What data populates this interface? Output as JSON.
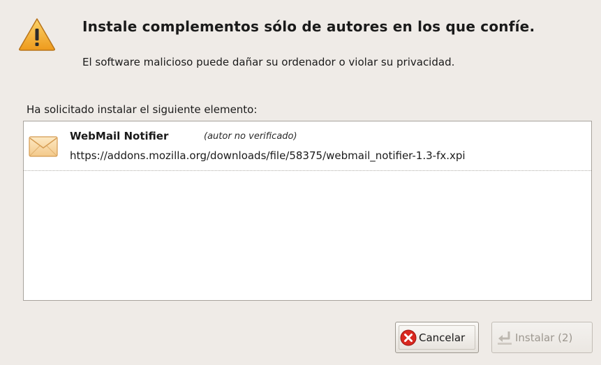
{
  "dialog": {
    "headline": "Instale complementos sólo de autores en los que confíe.",
    "subline": "El software malicioso puede dañar su ordenador o violar su privacidad.",
    "request_label": "Ha solicitado instalar el siguiente elemento:",
    "warning_icon": "warning-triangle-icon"
  },
  "addons": [
    {
      "name": "WebMail Notifier",
      "status": "(autor no verificado)",
      "url": "https://addons.mozilla.org/downloads/file/58375/webmail_notifier-1.3-fx.xpi",
      "icon": "envelope-icon"
    }
  ],
  "buttons": {
    "cancel_label": "Cancelar",
    "cancel_icon": "cancel-x-icon",
    "install_label": "Instalar (2)",
    "install_icon": "install-arrow-icon",
    "install_enabled": false
  },
  "colors": {
    "warning": "#f5b130",
    "cancel_icon": "#d9281f",
    "background": "#efebe7"
  }
}
